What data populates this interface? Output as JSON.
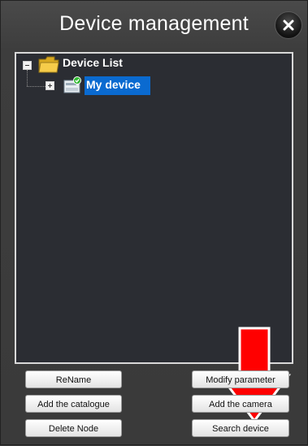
{
  "window": {
    "title": "Device management",
    "close_icon": "close-icon"
  },
  "tree": {
    "root": {
      "label": "Device List",
      "icon": "folder-icon",
      "expanded": true
    },
    "children": [
      {
        "label": "My device",
        "icon": "device-online-icon",
        "selected": true,
        "expanded": false
      }
    ]
  },
  "buttons": {
    "rename": "ReName",
    "add_catalogue": "Add the catalogue",
    "delete_node": "Delete Node",
    "modify_parameter": "Modify parameter",
    "add_camera": "Add the camera",
    "search_device": "Search device"
  },
  "annotation": {
    "icon": "red-down-arrow-icon",
    "color": "#ff0000"
  },
  "colors": {
    "selection": "#0a6ad0",
    "panel": "#2b2d33",
    "dialog": "#3a3a3a"
  }
}
